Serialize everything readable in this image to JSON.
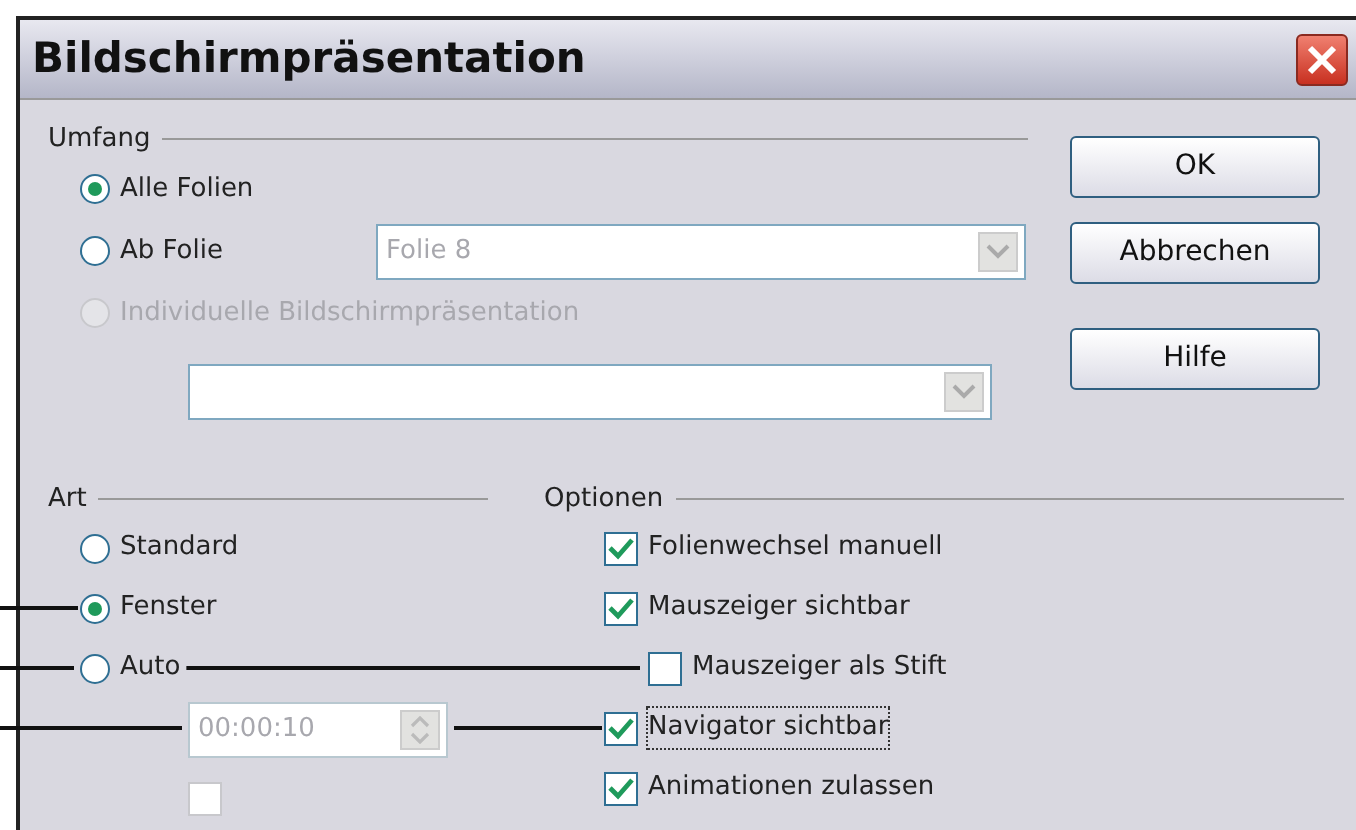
{
  "window": {
    "title": "Bildschirmpräsentation"
  },
  "scope": {
    "label": "Umfang",
    "options": [
      {
        "label": "Alle Folien",
        "selected": true,
        "disabled": false
      },
      {
        "label": "Ab Folie",
        "selected": false,
        "disabled": false
      },
      {
        "label": "Individuelle Bildschirmpräsentation",
        "selected": false,
        "disabled": true
      }
    ],
    "slide_combo": {
      "value": "Folie 8",
      "disabled": true
    }
  },
  "type": {
    "label": "Art",
    "options": [
      {
        "label": "Standard",
        "selected": false
      },
      {
        "label": "Fenster",
        "selected": true
      },
      {
        "label": "Auto",
        "selected": false
      }
    ],
    "timer": {
      "value": "00:00:10",
      "disabled": true
    },
    "pause_checkbox": {
      "checked": false,
      "disabled": true
    }
  },
  "options": {
    "label": "Optionen",
    "items": [
      {
        "label": "Folienwechsel manuell",
        "checked": true,
        "focused": false
      },
      {
        "label": "Mauszeiger sichtbar",
        "checked": true,
        "focused": false,
        "children": [
          {
            "label": "Mauszeiger als Stift",
            "checked": false,
            "focused": false
          }
        ]
      },
      {
        "label": "Navigator sichtbar",
        "checked": true,
        "focused": true
      },
      {
        "label": "Animationen zulassen",
        "checked": true,
        "focused": false
      }
    ]
  },
  "buttons": [
    "OK",
    "Abbrechen",
    "Hilfe"
  ]
}
